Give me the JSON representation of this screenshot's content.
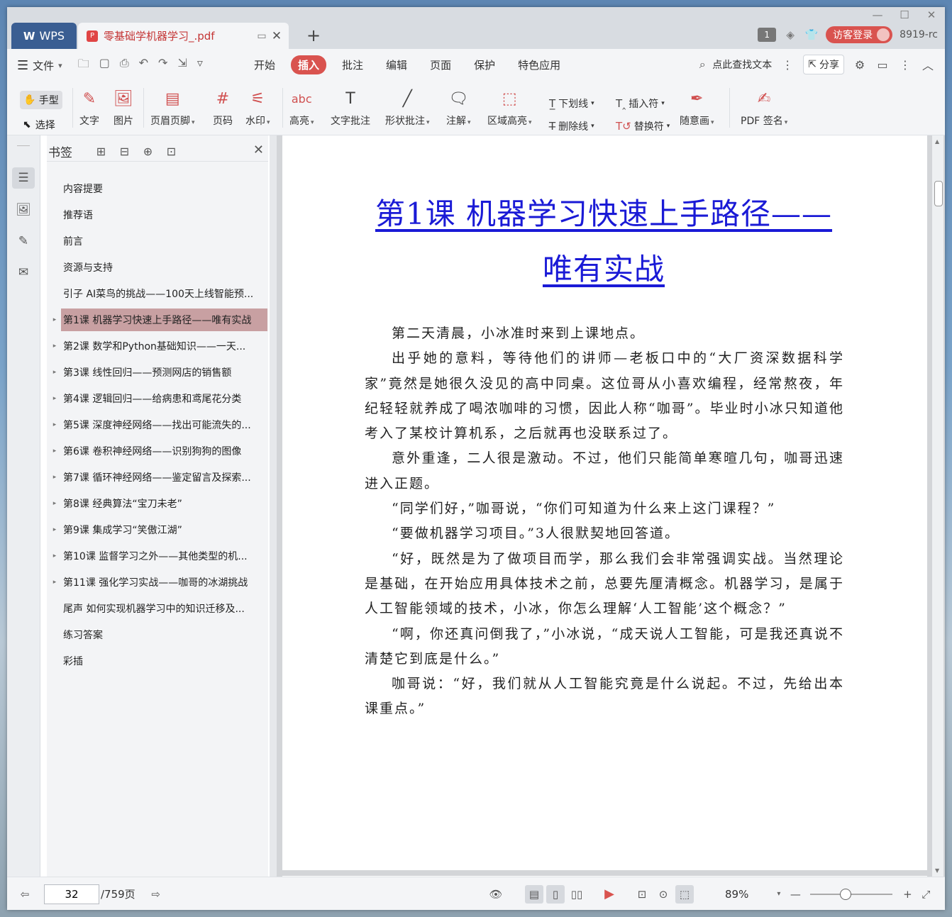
{
  "titlebar": {
    "app_tab": "WPS",
    "doc_tab": "零基础学机器学习_.pdf",
    "badge": "1",
    "visitor_login": "访客登录",
    "version": "8919-rc"
  },
  "menubar": {
    "file_menu": "文件",
    "tabs": [
      "开始",
      "插入",
      "批注",
      "编辑",
      "页面",
      "保护",
      "特色应用"
    ],
    "active_tab": "插入",
    "find_text": "点此查找文本",
    "share": "分享"
  },
  "toolbar": {
    "hand": "手型",
    "select": "选择",
    "text": "文字",
    "image": "图片",
    "header_footer": "页眉页脚",
    "page_number": "页码",
    "watermark": "水印",
    "highlight": "高亮",
    "text_annotation": "文字批注",
    "shape_annotation": "形状批注",
    "note": "注解",
    "area_highlight": "区域高亮",
    "underline": "下划线",
    "strikethrough": "删除线",
    "insert_mark": "插入符",
    "replace_mark": "替换符",
    "freehand": "随意画",
    "pdf_sign": "PDF 签名"
  },
  "bookmarks": {
    "title": "书签",
    "items": [
      {
        "label": "内容提要",
        "expandable": false
      },
      {
        "label": "推荐语",
        "expandable": false
      },
      {
        "label": "前言",
        "expandable": false
      },
      {
        "label": "资源与支持",
        "expandable": false
      },
      {
        "label": "引子 AI菜鸟的挑战——100天上线智能预...",
        "expandable": false
      },
      {
        "label": "第1课 机器学习快速上手路径——唯有实战",
        "expandable": true,
        "active": true
      },
      {
        "label": "第2课 数学和Python基础知识——一天...",
        "expandable": true
      },
      {
        "label": "第3课 线性回归——预测网店的销售额",
        "expandable": true
      },
      {
        "label": "第4课 逻辑回归——给病患和鸢尾花分类",
        "expandable": true
      },
      {
        "label": "第5课 深度神经网络——找出可能流失的...",
        "expandable": true
      },
      {
        "label": "第6课 卷积神经网络——识别狗狗的图像",
        "expandable": true
      },
      {
        "label": "第7课 循环神经网络——鉴定留言及探索...",
        "expandable": true
      },
      {
        "label": "第8课 经典算法“宝刀未老”",
        "expandable": true
      },
      {
        "label": "第9课 集成学习“笑傲江湖”",
        "expandable": true
      },
      {
        "label": "第10课 监督学习之外——其他类型的机...",
        "expandable": true
      },
      {
        "label": "第11课 强化学习实战——咖哥的冰湖挑战",
        "expandable": true
      },
      {
        "label": "尾声 如何实现机器学习中的知识迁移及...",
        "expandable": false
      },
      {
        "label": "练习答案",
        "expandable": false
      },
      {
        "label": "彩插",
        "expandable": false
      }
    ]
  },
  "document": {
    "heading_line1": "第1课 机器学习快速上手路径——",
    "heading_line2": "唯有实战",
    "paragraphs": [
      "第二天清晨，小冰准时来到上课地点。",
      "出乎她的意料，等待他们的讲师—老板口中的“大厂资深数据科学家”竟然是她很久没见的高中同桌。这位哥从小喜欢编程，经常熬夜，年纪轻轻就养成了喝浓咖啡的习惯，因此人称“咖哥”。毕业时小冰只知道他考入了某校计算机系，之后就再也没联系过了。",
      "意外重逢，二人很是激动。不过，他们只能简单寒暄几句，咖哥迅速进入正题。",
      "“同学们好，”咖哥说，“你们可知道为什么来上这门课程？”",
      "“要做机器学习项目。”3人很默契地回答道。",
      "“好，既然是为了做项目而学，那么我们会非常强调实战。当然理论是基础，在开始应用具体技术之前，总要先厘清概念。机器学习，是属于人工智能领域的技术，小冰，你怎么理解‘人工智能’这个概念？”",
      "“啊，你还真问倒我了，”小冰说，“成天说人工智能，可是我还真说不清楚它到底是什么。”",
      "咖哥说：“好，我们就从人工智能究竟是什么说起。不过，先给出本课重点。”"
    ]
  },
  "statusbar": {
    "current_page": "32",
    "total_pages": "/759页",
    "zoom": "89%"
  },
  "colors": {
    "accent": "#d9534f",
    "link_heading": "#1a1ad6",
    "bookmark_active": "#c8a0a2"
  }
}
